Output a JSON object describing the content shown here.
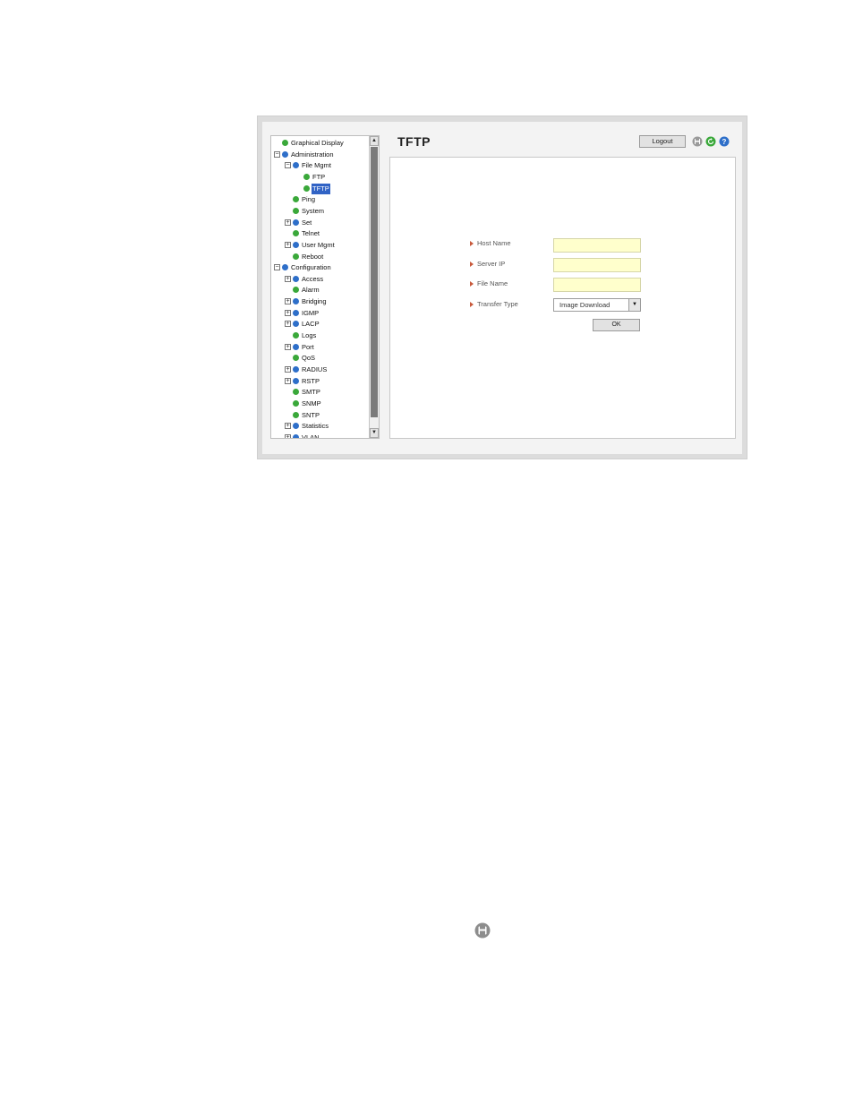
{
  "page": {
    "title": "TFTP"
  },
  "header": {
    "logout_label": "Logout"
  },
  "tree": [
    {
      "label": "Graphical Display",
      "level": 0,
      "exp": "",
      "icon": "green",
      "selected": false
    },
    {
      "label": "Administration",
      "level": 0,
      "exp": "minus",
      "icon": "blue",
      "selected": false
    },
    {
      "label": "File Mgmt",
      "level": 1,
      "exp": "minus",
      "icon": "blue",
      "selected": false
    },
    {
      "label": "FTP",
      "level": 2,
      "exp": "",
      "icon": "green",
      "selected": false
    },
    {
      "label": "TFTP",
      "level": 2,
      "exp": "",
      "icon": "green",
      "selected": true
    },
    {
      "label": "Ping",
      "level": 1,
      "exp": "",
      "icon": "green",
      "selected": false
    },
    {
      "label": "System",
      "level": 1,
      "exp": "",
      "icon": "green",
      "selected": false
    },
    {
      "label": "Set",
      "level": 1,
      "exp": "plus",
      "icon": "blue",
      "selected": false
    },
    {
      "label": "Telnet",
      "level": 1,
      "exp": "",
      "icon": "green",
      "selected": false
    },
    {
      "label": "User Mgmt",
      "level": 1,
      "exp": "plus",
      "icon": "blue",
      "selected": false
    },
    {
      "label": "Reboot",
      "level": 1,
      "exp": "",
      "icon": "green",
      "selected": false
    },
    {
      "label": "Configuration",
      "level": 0,
      "exp": "minus",
      "icon": "blue",
      "selected": false
    },
    {
      "label": "Access",
      "level": 1,
      "exp": "plus",
      "icon": "blue",
      "selected": false
    },
    {
      "label": "Alarm",
      "level": 1,
      "exp": "",
      "icon": "green",
      "selected": false
    },
    {
      "label": "Bridging",
      "level": 1,
      "exp": "plus",
      "icon": "blue",
      "selected": false
    },
    {
      "label": "IGMP",
      "level": 1,
      "exp": "plus",
      "icon": "blue",
      "selected": false
    },
    {
      "label": "LACP",
      "level": 1,
      "exp": "plus",
      "icon": "blue",
      "selected": false
    },
    {
      "label": "Logs",
      "level": 1,
      "exp": "",
      "icon": "green",
      "selected": false
    },
    {
      "label": "Port",
      "level": 1,
      "exp": "plus",
      "icon": "blue",
      "selected": false
    },
    {
      "label": "QoS",
      "level": 1,
      "exp": "",
      "icon": "green",
      "selected": false
    },
    {
      "label": "RADIUS",
      "level": 1,
      "exp": "plus",
      "icon": "blue",
      "selected": false
    },
    {
      "label": "RSTP",
      "level": 1,
      "exp": "plus",
      "icon": "blue",
      "selected": false
    },
    {
      "label": "SMTP",
      "level": 1,
      "exp": "",
      "icon": "green",
      "selected": false
    },
    {
      "label": "SNMP",
      "level": 1,
      "exp": "",
      "icon": "green",
      "selected": false
    },
    {
      "label": "SNTP",
      "level": 1,
      "exp": "",
      "icon": "green",
      "selected": false
    },
    {
      "label": "Statistics",
      "level": 1,
      "exp": "plus",
      "icon": "blue",
      "selected": false
    },
    {
      "label": "VLAN",
      "level": 1,
      "exp": "plus",
      "icon": "blue",
      "selected": false
    }
  ],
  "form": {
    "host_name_label": "Host Name",
    "host_name_value": "",
    "server_ip_label": "Server IP",
    "server_ip_value": "",
    "file_name_label": "File Name",
    "file_name_value": "",
    "transfer_type_label": "Transfer Type",
    "transfer_type_value": "Image Download",
    "ok_label": "OK"
  },
  "icons": {
    "save": "save-icon",
    "refresh": "refresh-icon",
    "help": "help-icon",
    "save_standalone": "save-icon"
  },
  "colors": {
    "selected": "#3163c5",
    "input_bg": "#ffffcc",
    "green_bullet": "#3aa83a",
    "blue_bullet": "#2e6fc9"
  }
}
